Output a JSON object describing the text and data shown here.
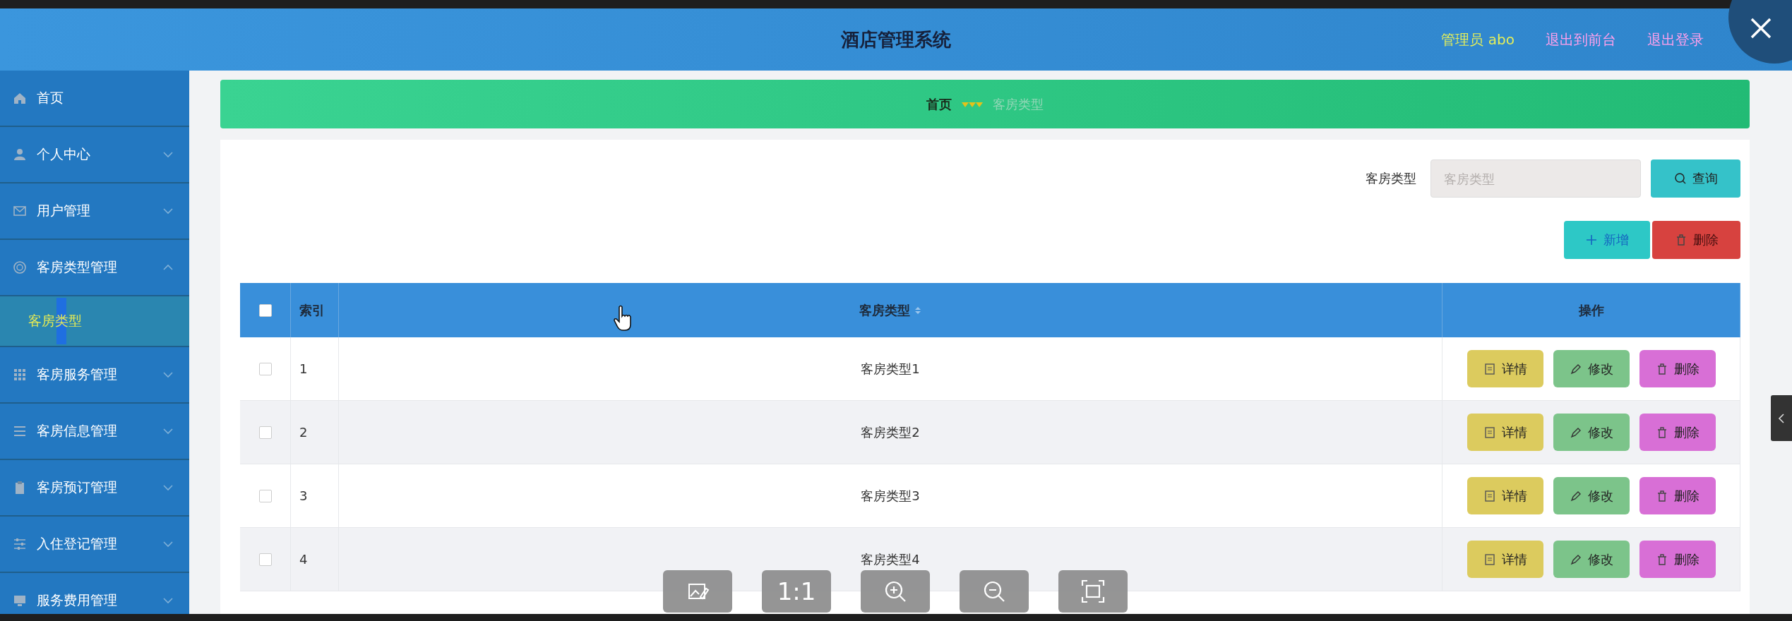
{
  "header": {
    "title": "酒店管理系统",
    "user": "管理员 abo",
    "links": [
      "退出到前台",
      "退出登录"
    ]
  },
  "sidebar": {
    "items": [
      {
        "label": "首页",
        "kind": "link"
      },
      {
        "label": "个人中心",
        "kind": "group",
        "expanded": false
      },
      {
        "label": "用户管理",
        "kind": "group",
        "expanded": false
      },
      {
        "label": "客房类型管理",
        "kind": "group",
        "expanded": true,
        "children": [
          {
            "label": "客房类型",
            "selected": true
          }
        ]
      },
      {
        "label": "客房服务管理",
        "kind": "group",
        "expanded": false
      },
      {
        "label": "客房信息管理",
        "kind": "group",
        "expanded": false
      },
      {
        "label": "客房预订管理",
        "kind": "group",
        "expanded": false
      },
      {
        "label": "入住登记管理",
        "kind": "group",
        "expanded": false
      },
      {
        "label": "服务费用管理",
        "kind": "group",
        "expanded": false
      }
    ]
  },
  "breadcrumb": {
    "items": [
      {
        "label": "首页",
        "current": false
      },
      {
        "label": "客房类型",
        "current": true
      }
    ]
  },
  "search": {
    "label": "客房类型",
    "placeholder": "客房类型",
    "button": "查询"
  },
  "actions": [
    {
      "label": "新增",
      "kind": "add"
    },
    {
      "label": "删除",
      "kind": "delete"
    }
  ],
  "table": {
    "columns": [
      {
        "kind": "checkbox",
        "checked": false
      },
      {
        "label": "索引"
      },
      {
        "label": "客房类型",
        "sortable": true
      },
      {
        "label": "操作"
      }
    ],
    "rows": [
      {
        "checked": false,
        "index": "1",
        "room_type": "客房类型1",
        "actions": [
          {
            "label": "详情",
            "kind": "detail"
          },
          {
            "label": "修改",
            "kind": "edit"
          },
          {
            "label": "删除",
            "kind": "delete"
          }
        ]
      },
      {
        "checked": false,
        "index": "2",
        "room_type": "客房类型2",
        "actions": [
          {
            "label": "详情",
            "kind": "detail"
          },
          {
            "label": "修改",
            "kind": "edit"
          },
          {
            "label": "删除",
            "kind": "delete"
          }
        ]
      },
      {
        "checked": false,
        "index": "3",
        "room_type": "客房类型3",
        "actions": [
          {
            "label": "详情",
            "kind": "detail"
          },
          {
            "label": "修改",
            "kind": "edit"
          },
          {
            "label": "删除",
            "kind": "delete"
          }
        ]
      },
      {
        "checked": false,
        "index": "4",
        "room_type": "客房类型4",
        "actions": [
          {
            "label": "详情",
            "kind": "detail"
          },
          {
            "label": "修改",
            "kind": "edit"
          },
          {
            "label": "删除",
            "kind": "delete"
          }
        ]
      }
    ]
  },
  "viewer_toolbar": [
    {
      "kind": "edit-image"
    },
    {
      "kind": "actual-size",
      "label": "1:1"
    },
    {
      "kind": "zoom-in"
    },
    {
      "kind": "zoom-out"
    },
    {
      "kind": "fit"
    }
  ]
}
